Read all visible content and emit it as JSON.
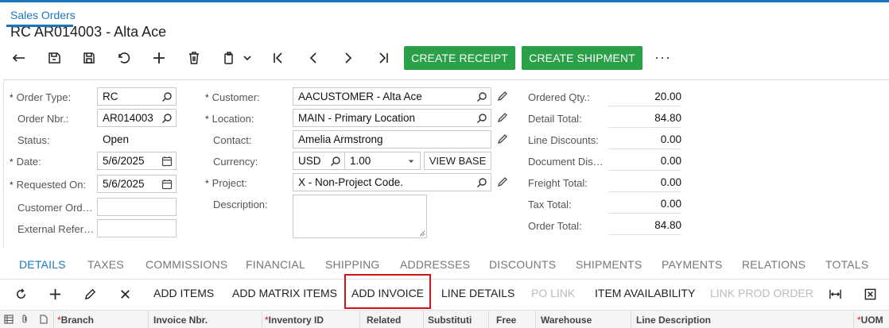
{
  "breadcrumb": "Sales Orders",
  "title": "RC AR014003 - Alta Ace",
  "toolbar": {
    "icons": [
      "back-icon",
      "save-close-icon",
      "save-icon",
      "undo-icon",
      "add-icon",
      "delete-icon",
      "copy-paste-icon",
      "first-icon",
      "previous-icon",
      "next-icon",
      "last-icon"
    ],
    "create_receipt": "CREATE RECEIPT",
    "create_shipment": "CREATE SHIPMENT",
    "more": "···"
  },
  "form": {
    "order_type": {
      "label": "Order Type:",
      "value": "RC"
    },
    "order_nbr": {
      "label": "Order Nbr.:",
      "value": "AR014003"
    },
    "status": {
      "label": "Status:",
      "value": "Open"
    },
    "date": {
      "label": "Date:",
      "value": "5/6/2025"
    },
    "requested_on": {
      "label": "Requested On:",
      "value": "5/6/2025"
    },
    "customer_ord": {
      "label": "Customer Ord…",
      "value": ""
    },
    "external_ref": {
      "label": "External Refer…",
      "value": ""
    },
    "customer": {
      "label": "Customer:",
      "value": "AACUSTOMER - Alta Ace"
    },
    "location": {
      "label": "Location:",
      "value": "MAIN - Primary Location"
    },
    "contact": {
      "label": "Contact:",
      "value": "Amelia Armstrong"
    },
    "currency": {
      "label": "Currency:",
      "value": "USD",
      "rate": "1.00",
      "view_base": "VIEW BASE"
    },
    "project": {
      "label": "Project:",
      "value": "X - Non-Project Code."
    },
    "description": {
      "label": "Description:",
      "value": ""
    }
  },
  "totals": [
    {
      "label": "Ordered Qty.:",
      "value": "20.00"
    },
    {
      "label": "Detail Total:",
      "value": "84.80"
    },
    {
      "label": "Line Discounts:",
      "value": "0.00"
    },
    {
      "label": "Document Dis…",
      "value": "0.00"
    },
    {
      "label": "Freight Total:",
      "value": "0.00"
    },
    {
      "label": "Tax Total:",
      "value": "0.00"
    },
    {
      "label": "Order Total:",
      "value": "84.80"
    }
  ],
  "tabs": [
    "DETAILS",
    "TAXES",
    "COMMISSIONS",
    "FINANCIAL",
    "SHIPPING",
    "ADDRESSES",
    "DISCOUNTS",
    "SHIPMENTS",
    "PAYMENTS",
    "RELATIONS",
    "TOTALS"
  ],
  "grid_toolbar": {
    "add_items": "ADD ITEMS",
    "add_matrix_items": "ADD MATRIX ITEMS",
    "add_invoice": "ADD INVOICE",
    "line_details": "LINE DETAILS",
    "po_link": "PO LINK",
    "item_availability": "ITEM AVAILABILITY",
    "link_prod_order": "LINK PROD ORDER"
  },
  "grid_columns": [
    "Branch",
    "Invoice Nbr.",
    "Inventory ID",
    "Related",
    "Substituti",
    "Free",
    "Warehouse",
    "Line Description",
    "UOM"
  ],
  "colors": {
    "accent": "#1a78c2",
    "green": "#2aa148",
    "highlight": "#d0111a"
  }
}
